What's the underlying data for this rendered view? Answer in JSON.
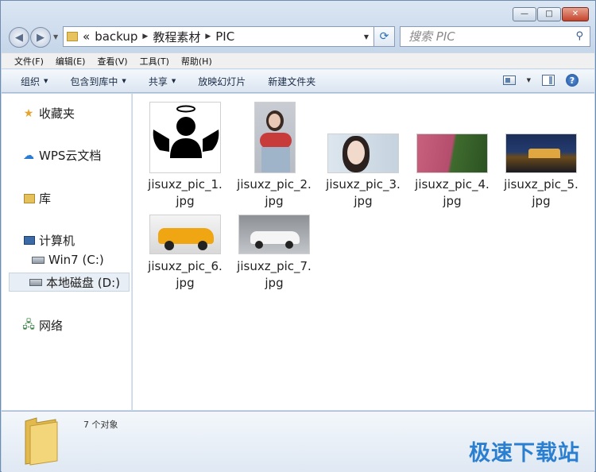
{
  "address": {
    "overflow": "«",
    "crumbs": [
      "backup",
      "教程素材",
      "PIC"
    ]
  },
  "search": {
    "placeholder": "搜索 PIC"
  },
  "menu": [
    "文件(F)",
    "编辑(E)",
    "查看(V)",
    "工具(T)",
    "帮助(H)"
  ],
  "toolbar": {
    "organize": "组织",
    "include_in_library": "包含到库中",
    "share": "共享",
    "slideshow": "放映幻灯片",
    "new_folder": "新建文件夹"
  },
  "nav": {
    "favorites": "收藏夹",
    "wps_cloud": "WPS云文档",
    "libraries": "库",
    "computer": "计算机",
    "drive_c": "Win7 (C:)",
    "drive_d": "本地磁盘 (D:)",
    "network": "网络"
  },
  "files": [
    {
      "line1": "jisuxz_pic_1.",
      "line2": "jpg"
    },
    {
      "line1": "jisuxz_pic_2.",
      "line2": "jpg"
    },
    {
      "line1": "jisuxz_pic_3.",
      "line2": "jpg"
    },
    {
      "line1": "jisuxz_pic_4.",
      "line2": "jpg"
    },
    {
      "line1": "jisuxz_pic_5.",
      "line2": "jpg"
    },
    {
      "line1": "jisuxz_pic_6.",
      "line2": "jpg"
    },
    {
      "line1": "jisuxz_pic_7.",
      "line2": "jpg"
    }
  ],
  "status": {
    "count": "7 个对象"
  },
  "watermark": "极速下载站",
  "icons": {
    "favorites": "star-icon",
    "wps_cloud": "cloud-icon",
    "libraries": "library-icon",
    "computer": "computer-icon",
    "drive": "drive-icon",
    "network": "network-icon"
  },
  "colors": {
    "accent": "#2b7fd0",
    "close": "#c4442c"
  }
}
